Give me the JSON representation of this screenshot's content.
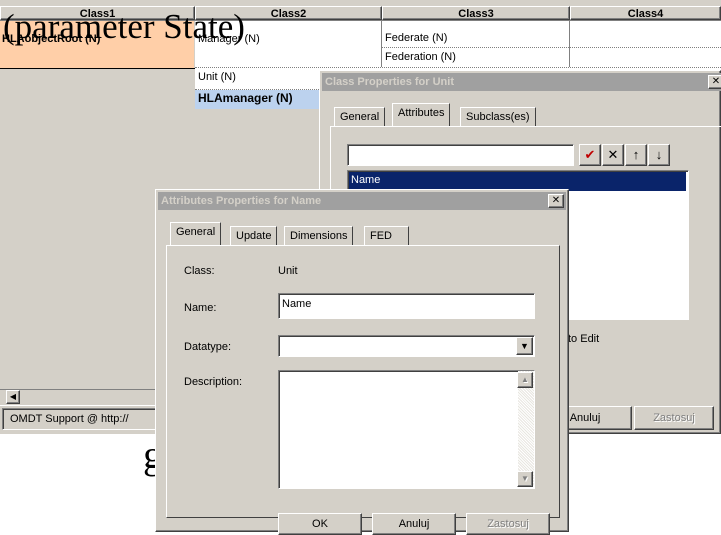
{
  "grid": {
    "headers": [
      "Class1",
      "Class2",
      "Class3",
      "Class4"
    ],
    "cells": {
      "class1_row1": "HLAobjectRoot (N)",
      "class2_row1": "Manager (N)",
      "class2_row3": "Unit (N)",
      "class2_row4": "HLAmanager (N)",
      "class3_row1": "Federate (N)",
      "class3_row2": "Federation (N)"
    }
  },
  "overlay_text": "(parameter State)",
  "overlay_fragment": "g",
  "status_bar": {
    "text": "OMDT Support @ http://"
  },
  "colors": {
    "accent_selection": "#0a246a",
    "class1_highlight": "#ffcfa8",
    "selected_cell": "#bcd2ee"
  },
  "class_dialog": {
    "title": "Class Properties for Unit",
    "close_glyph": "✕",
    "tabs": [
      "General",
      "Attributes",
      "Subclass(es)"
    ],
    "active_tab": "Attributes",
    "filter_value": "",
    "toolbar": {
      "check": "✔",
      "delete": "✕",
      "up": "↑",
      "down": "↓"
    },
    "list_items": [
      "Name"
    ],
    "hint_text": "to Edit",
    "buttons": {
      "cancel": "Anuluj",
      "apply": "Zastosuj"
    }
  },
  "attr_dialog": {
    "title": "Attributes Properties for Name",
    "close_glyph": "✕",
    "tabs": [
      "General",
      "Update",
      "Dimensions",
      "FED"
    ],
    "active_tab": "General",
    "fields": {
      "class_label": "Class:",
      "class_value": "Unit",
      "name_label": "Name:",
      "name_value": "Name",
      "datatype_label": "Datatype:",
      "datatype_value": "",
      "description_label": "Description:",
      "description_value": ""
    },
    "buttons": {
      "ok": "OK",
      "cancel": "Anuluj",
      "apply": "Zastosuj"
    }
  }
}
